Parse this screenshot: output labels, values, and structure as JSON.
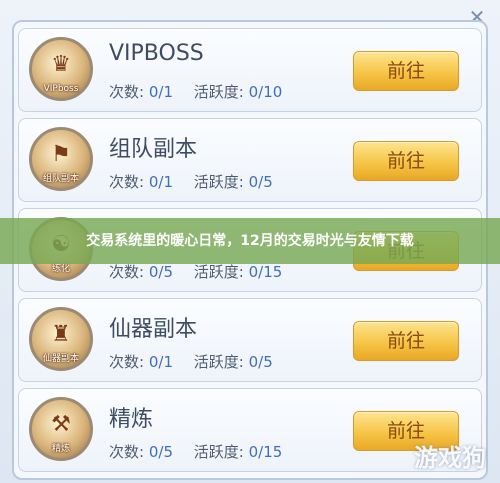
{
  "banner_text": "交易系统里的暖心日常，12月的交易时光与友情下载",
  "watermark": "游戏狗",
  "labels": {
    "count": "次数:",
    "activity": "活跃度:"
  },
  "rows": [
    {
      "icon": "vipboss-icon",
      "icon_caption": "VIPboss",
      "title": "VIPBOSS",
      "count": "0/1",
      "activity": "0/10",
      "button": "前往"
    },
    {
      "icon": "team-dungeon-icon",
      "icon_caption": "组队副本",
      "title": "组队副本",
      "count": "0/1",
      "activity": "0/5",
      "button": "前往"
    },
    {
      "icon": "training-icon",
      "icon_caption": "练化",
      "title": "",
      "count": "0/5",
      "activity": "0/15",
      "button": "前往"
    },
    {
      "icon": "artifact-dungeon-icon",
      "icon_caption": "仙器副本",
      "title": "仙器副本",
      "count": "0/1",
      "activity": "0/5",
      "button": "前往"
    },
    {
      "icon": "refine-icon",
      "icon_caption": "精炼",
      "title": "精炼",
      "count": "0/5",
      "activity": "0/15",
      "button": "前往"
    }
  ]
}
